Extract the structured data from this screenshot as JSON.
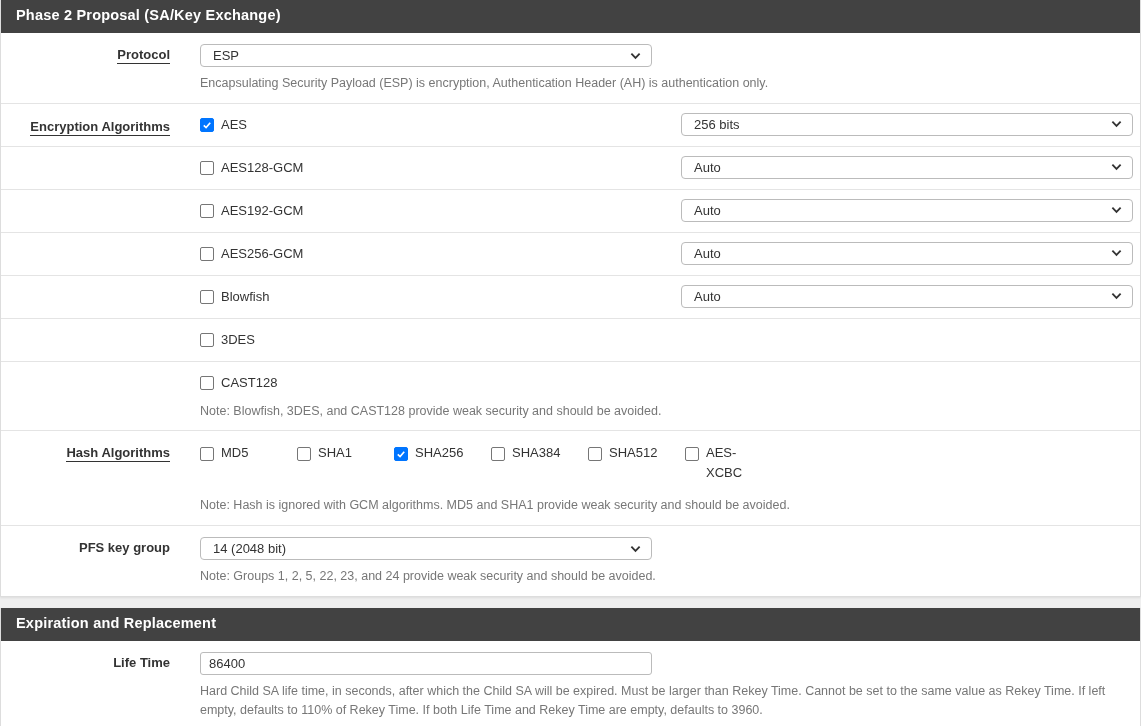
{
  "sections": [
    {
      "title": "Phase 2 Proposal (SA/Key Exchange)",
      "rows": [
        {
          "kind": "select",
          "label": "Protocol",
          "underlined": true,
          "value": "ESP",
          "help": "Encapsulating Security Payload (ESP) is encryption, Authentication Header (AH) is authentication only."
        },
        {
          "kind": "algorithm",
          "label": "Encryption Algorithms",
          "underlined": true,
          "name": "AES",
          "checked": true,
          "keylen": "256 bits"
        },
        {
          "kind": "algorithm",
          "name": "AES128-GCM",
          "checked": false,
          "keylen": "Auto"
        },
        {
          "kind": "algorithm",
          "name": "AES192-GCM",
          "checked": false,
          "keylen": "Auto"
        },
        {
          "kind": "algorithm",
          "name": "AES256-GCM",
          "checked": false,
          "keylen": "Auto"
        },
        {
          "kind": "algorithm",
          "name": "Blowfish",
          "checked": false,
          "keylen": "Auto"
        },
        {
          "kind": "algorithm",
          "name": "3DES",
          "checked": false
        },
        {
          "kind": "algorithm",
          "name": "CAST128",
          "checked": false,
          "help": "Note: Blowfish, 3DES, and CAST128 provide weak security and should be avoided."
        },
        {
          "kind": "checkbox_group",
          "label": "Hash Algorithms",
          "underlined": true,
          "options": [
            {
              "name": "MD5",
              "checked": false
            },
            {
              "name": "SHA1",
              "checked": false
            },
            {
              "name": "SHA256",
              "checked": true
            },
            {
              "name": "SHA384",
              "checked": false
            },
            {
              "name": "SHA512",
              "checked": false
            },
            {
              "name": "AES-XCBC",
              "checked": false
            }
          ],
          "help": "Note: Hash is ignored with GCM algorithms. MD5 and SHA1 provide weak security and should be avoided."
        },
        {
          "kind": "select",
          "label": "PFS key group",
          "underlined": false,
          "value": "14 (2048 bit)",
          "help": "Note: Groups 1, 2, 5, 22, 23, and 24 provide weak security and should be avoided."
        }
      ]
    },
    {
      "title": "Expiration and Replacement",
      "rows": [
        {
          "kind": "input",
          "label": "Life Time",
          "underlined": false,
          "value": "86400",
          "help": "Hard Child SA life time, in seconds, after which the Child SA will be expired. Must be larger than Rekey Time. Cannot be set to the same value as Rekey Time. If left empty, defaults to 110% of Rekey Time. If both Life Time and Rekey Time are empty, defaults to 3960."
        }
      ]
    }
  ]
}
